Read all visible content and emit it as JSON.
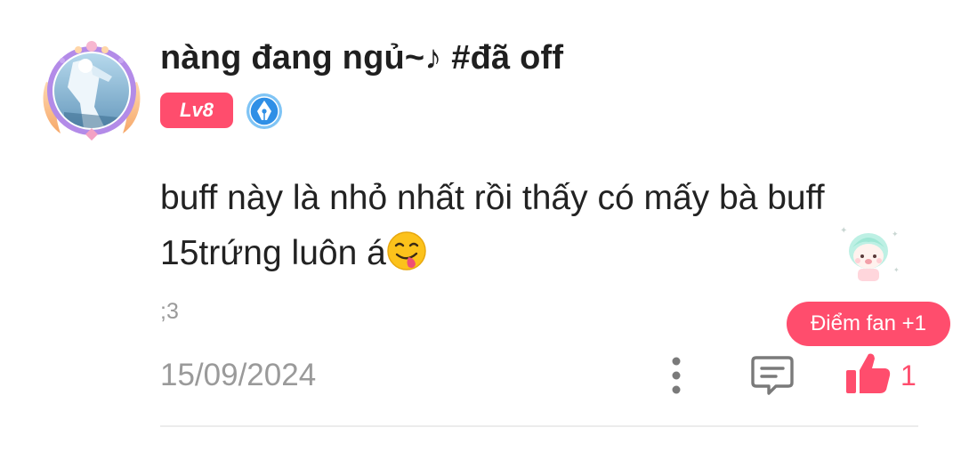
{
  "comment": {
    "username": "nàng đang ngủ~♪ #đã off",
    "level": "Lv8",
    "text": "buff này là nhỏ nhất rồi thấy có mấy bà buff 15trứng luôn á",
    "emoji_icon": "yum-face-icon",
    "sub_text": ";3",
    "date": "15/09/2024",
    "like_count": "1",
    "fan_badge": "Điểm fan +1"
  },
  "colors": {
    "accent": "#ff4d6d",
    "text": "#222222",
    "muted": "#9a9a9a",
    "pen_badge": "#2f8fe6"
  },
  "icons": {
    "pen": "pen-nib-icon",
    "more": "more-vertical-icon",
    "reply": "comment-icon",
    "like": "thumbs-up-icon",
    "sticker": "cute-character-sticker-icon"
  }
}
